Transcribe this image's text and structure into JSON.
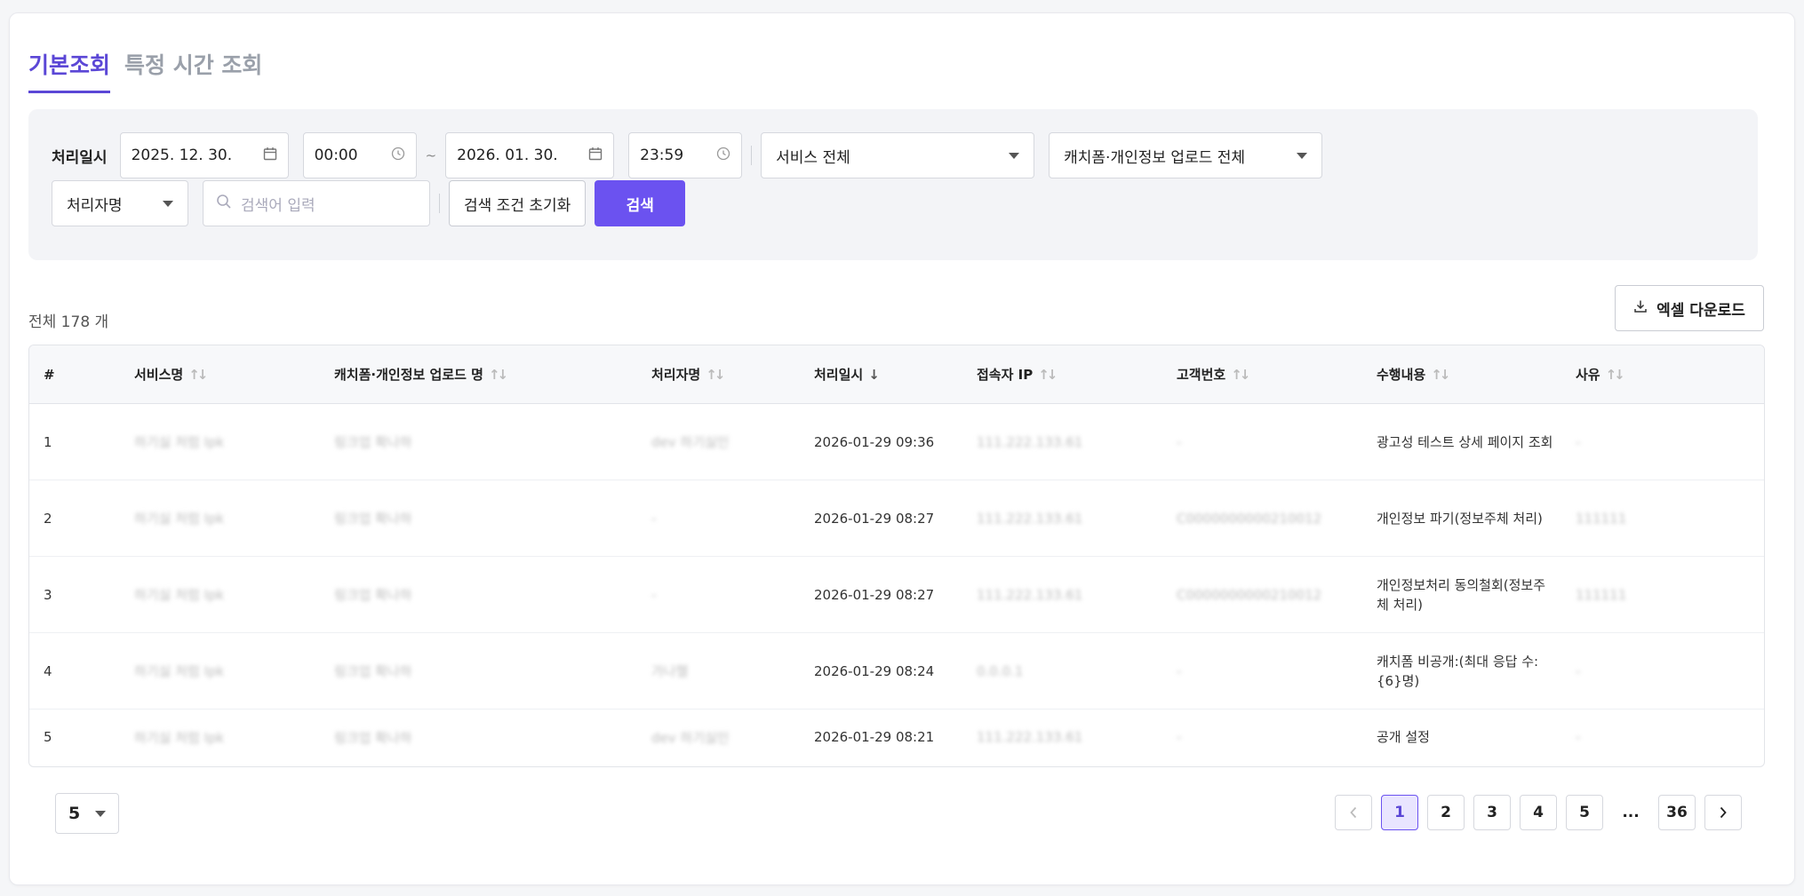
{
  "tabs": [
    {
      "label": "기본조회",
      "active": true
    },
    {
      "label": "특정 시간 조회",
      "active": false
    }
  ],
  "filter": {
    "date_label": "처리일시",
    "start_date": "2025. 12. 30.",
    "start_time": "00:00",
    "tilde": "~",
    "end_date": "2026. 01. 30.",
    "end_time": "23:59",
    "service_select": "서비스 전체",
    "upload_select": "캐치폼·개인정보 업로드 전체",
    "field_select": "처리자명",
    "search_placeholder": "검색어 입력",
    "reset_label": "검색 조건 초기화",
    "search_label": "검색"
  },
  "summary": {
    "total": "전체 178 개"
  },
  "excel_label": "엑셀 다운로드",
  "table": {
    "headers": [
      "#",
      "서비스명",
      "캐치폼·개인정보 업로드 명",
      "처리자명",
      "처리일시",
      "접속자 IP",
      "고객번호",
      "수행내용",
      "사유"
    ],
    "rows": [
      {
        "no": "1",
        "service": "하기싫 처럼 Ipk",
        "upload": "링크업 확나하",
        "user": "dev 하기싫인",
        "datetime": "2026-01-29 09:36",
        "ip": "111.222.133.61",
        "customer": "-",
        "action": "광고성 테스트 상세 페이지 조회",
        "reason": "-"
      },
      {
        "no": "2",
        "service": "하기싫 처럼 Ipk",
        "upload": "링크업 확나하",
        "user": "-",
        "datetime": "2026-01-29 08:27",
        "ip": "111.222.133.61",
        "customer": "C0000000000210012",
        "action": "개인정보 파기(정보주체 처리)",
        "reason": "111111"
      },
      {
        "no": "3",
        "service": "하기싫 처럼 Ipk",
        "upload": "링크업 확나하",
        "user": "-",
        "datetime": "2026-01-29 08:27",
        "ip": "111.222.133.61",
        "customer": "C0000000000210012",
        "action": "개인정보처리 동의철회(정보주체 처리)",
        "reason": "111111"
      },
      {
        "no": "4",
        "service": "하기싫 처럼 Ipk",
        "upload": "링크업 확나하",
        "user": "가나헬",
        "datetime": "2026-01-29 08:24",
        "ip": "0.0.0.1",
        "customer": "-",
        "action": "캐치폼 비공개:(최대 응답 수: {6}명)",
        "reason": "-"
      },
      {
        "no": "5",
        "service": "하기싫 처럼 Ipk",
        "upload": "링크업 확나하",
        "user": "dev 하기싫인",
        "datetime": "2026-01-29 08:21",
        "ip": "111.222.133.61",
        "customer": "-",
        "action": "공개 설정",
        "reason": "-"
      }
    ]
  },
  "pagination": {
    "page_size": "5",
    "pages": [
      "1",
      "2",
      "3",
      "4",
      "5",
      "...",
      "36"
    ],
    "current": "1"
  },
  "colors": {
    "accent": "#6b52f0",
    "active_tab": "#5b47d6"
  }
}
